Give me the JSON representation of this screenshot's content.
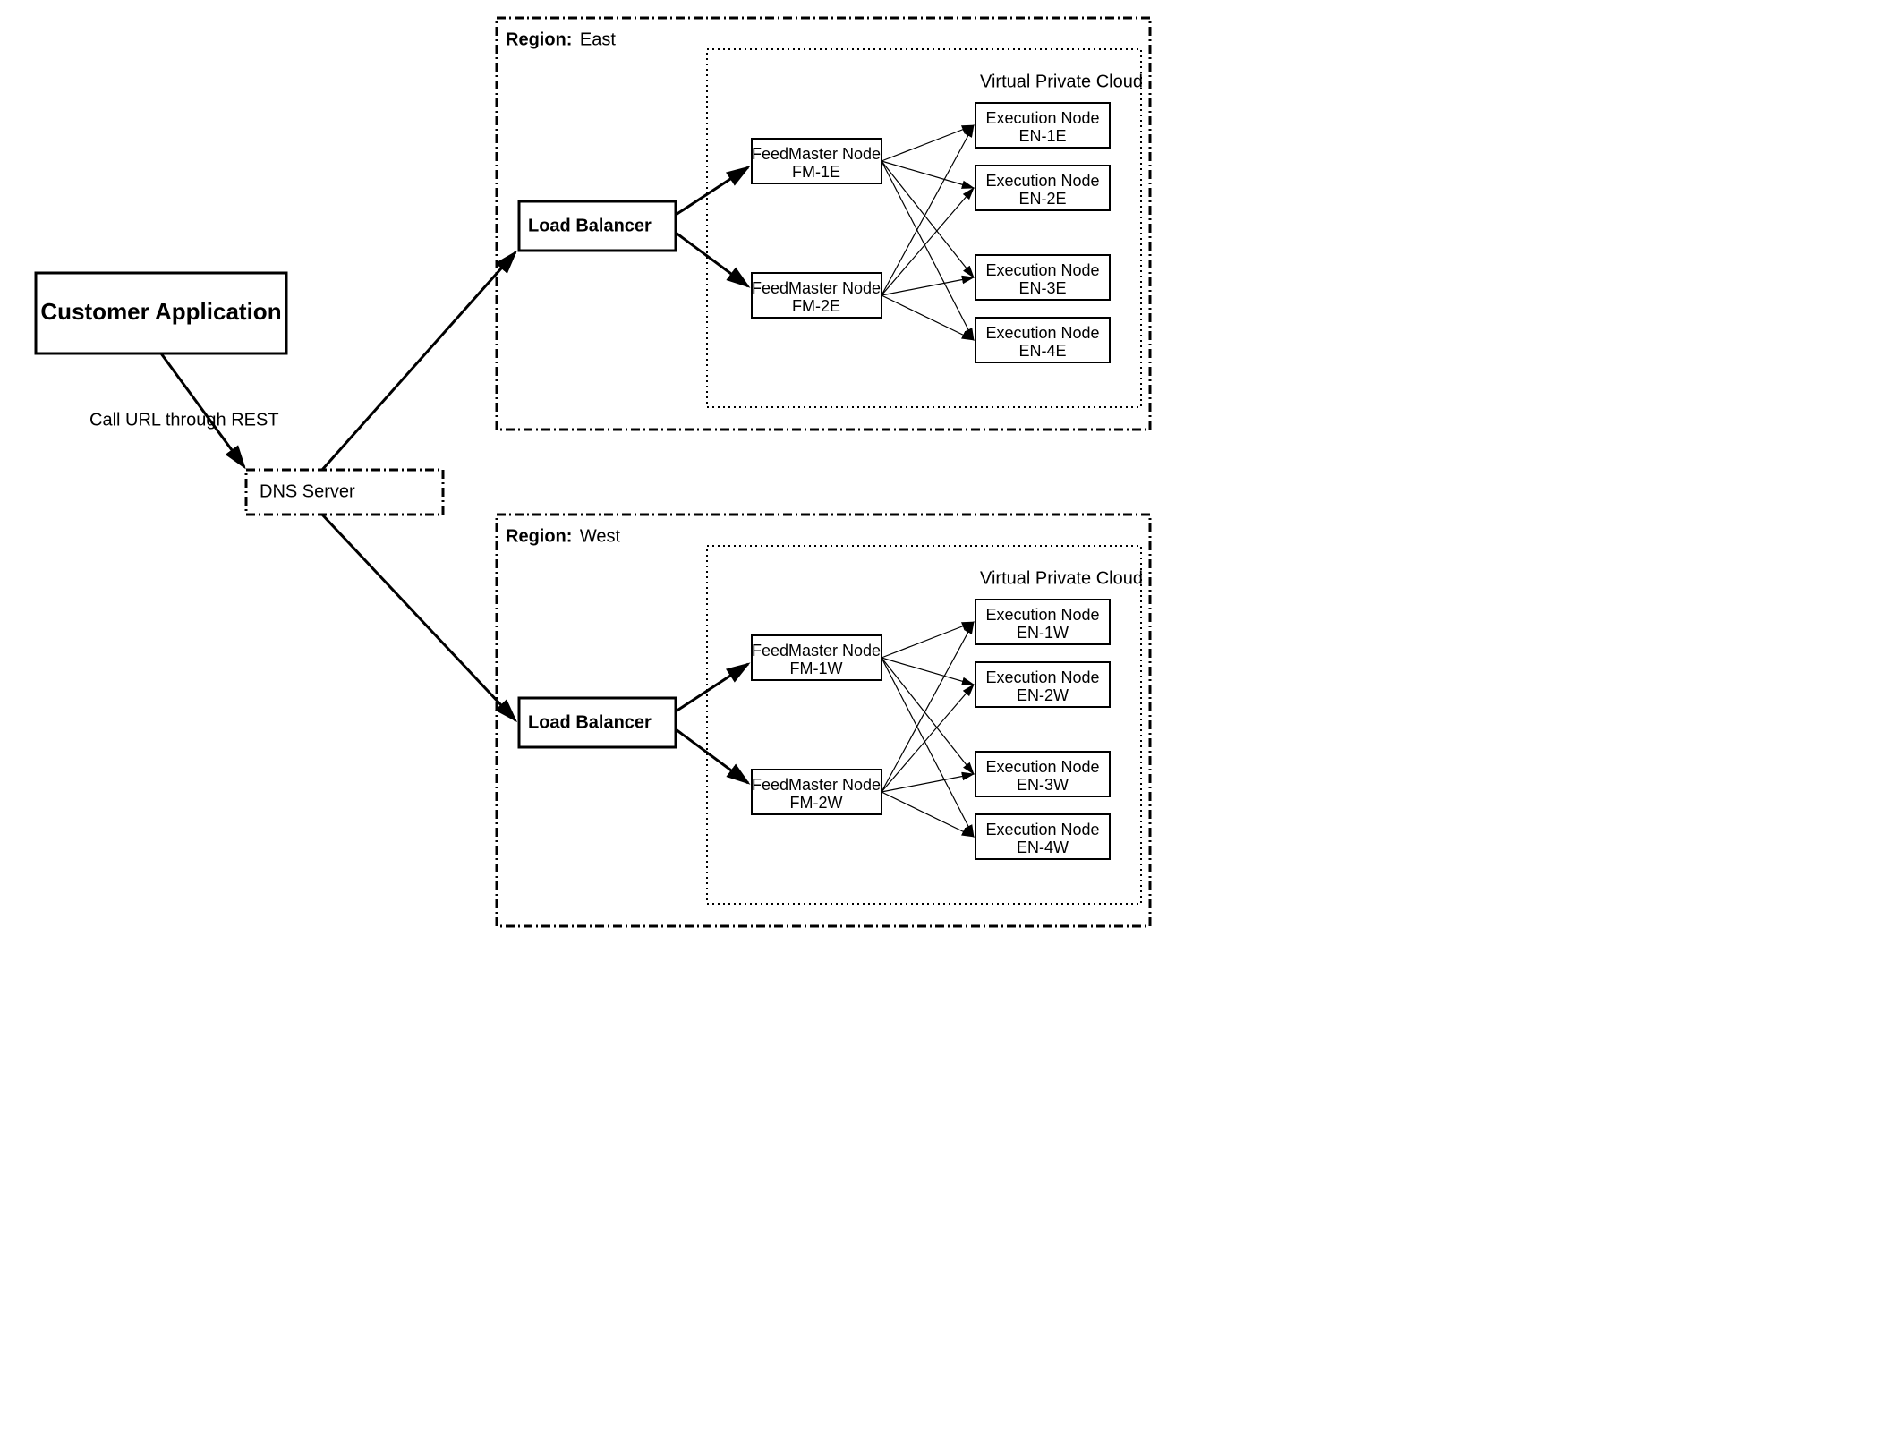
{
  "customer_app": {
    "label": "Customer Application"
  },
  "call_url_label": "Call URL through REST",
  "dns_server": {
    "label": "DNS Server"
  },
  "regions": {
    "east": {
      "title_prefix": "Region:",
      "title_name": "East",
      "vpc_label": "Virtual Private Cloud",
      "load_balancer": {
        "label": "Load Balancer"
      },
      "feedmasters": [
        {
          "title": "FeedMaster Node",
          "id": "FM-1E"
        },
        {
          "title": "FeedMaster Node",
          "id": "FM-2E"
        }
      ],
      "execution_nodes": [
        {
          "title": "Execution Node",
          "id": "EN-1E"
        },
        {
          "title": "Execution Node",
          "id": "EN-2E"
        },
        {
          "title": "Execution Node",
          "id": "EN-3E"
        },
        {
          "title": "Execution Node",
          "id": "EN-4E"
        }
      ]
    },
    "west": {
      "title_prefix": "Region:",
      "title_name": "West",
      "vpc_label": "Virtual Private Cloud",
      "load_balancer": {
        "label": "Load Balancer"
      },
      "feedmasters": [
        {
          "title": "FeedMaster Node",
          "id": "FM-1W"
        },
        {
          "title": "FeedMaster Node",
          "id": "FM-2W"
        }
      ],
      "execution_nodes": [
        {
          "title": "Execution Node",
          "id": "EN-1W"
        },
        {
          "title": "Execution Node",
          "id": "EN-2W"
        },
        {
          "title": "Execution Node",
          "id": "EN-3W"
        },
        {
          "title": "Execution Node",
          "id": "EN-4W"
        }
      ]
    }
  }
}
